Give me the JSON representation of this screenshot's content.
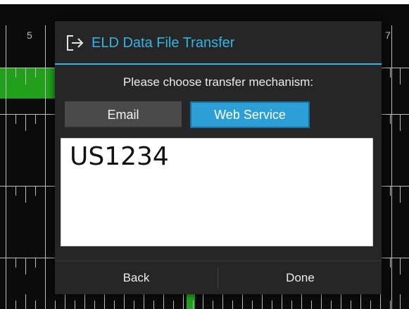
{
  "background": {
    "hour_labels": [
      "5",
      "7"
    ]
  },
  "dialog": {
    "title": "ELD Data File Transfer",
    "title_icon": "exit-arrow-icon",
    "accent_color": "#33b5e5",
    "prompt": "Please choose transfer mechanism:",
    "options": [
      {
        "label": "Email",
        "selected": false
      },
      {
        "label": "Web Service",
        "selected": true
      }
    ],
    "value": "US1234",
    "buttons": {
      "back": "Back",
      "done": "Done"
    }
  }
}
